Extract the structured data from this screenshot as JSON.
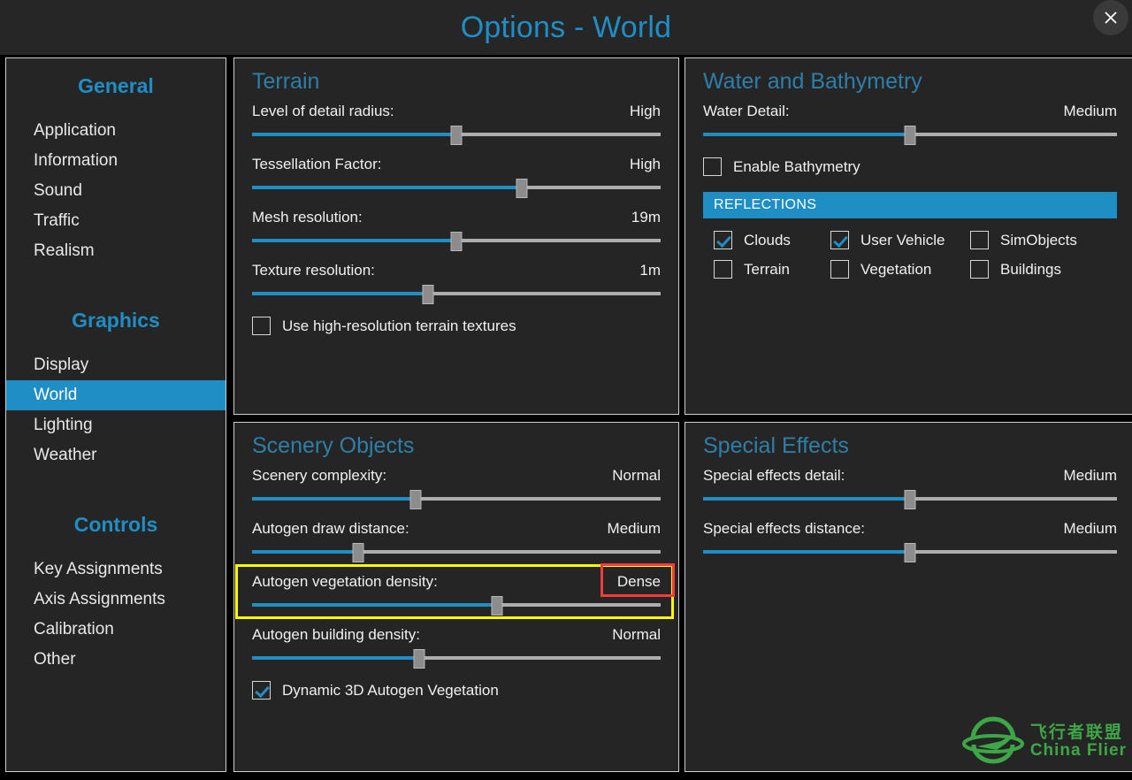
{
  "window": {
    "title": "Options - World",
    "close_label": "×",
    "accent_color": "#1f8ec4",
    "panel_bg": "#252525",
    "highlight_yellow": "#ffff00",
    "highlight_red": "#f03c3c"
  },
  "sidebar": {
    "groups": [
      {
        "heading": "General",
        "items": [
          {
            "label": "Application",
            "active": false
          },
          {
            "label": "Information",
            "active": false
          },
          {
            "label": "Sound",
            "active": false
          },
          {
            "label": "Traffic",
            "active": false
          },
          {
            "label": "Realism",
            "active": false
          }
        ]
      },
      {
        "heading": "Graphics",
        "items": [
          {
            "label": "Display",
            "active": false
          },
          {
            "label": "World",
            "active": true
          },
          {
            "label": "Lighting",
            "active": false
          },
          {
            "label": "Weather",
            "active": false
          }
        ]
      },
      {
        "heading": "Controls",
        "items": [
          {
            "label": "Key Assignments",
            "active": false
          },
          {
            "label": "Axis Assignments",
            "active": false
          },
          {
            "label": "Calibration",
            "active": false
          },
          {
            "label": "Other",
            "active": false
          }
        ]
      }
    ]
  },
  "terrain": {
    "title": "Terrain",
    "sliders": [
      {
        "label": "Level of detail radius:",
        "value": "High",
        "percent": 50
      },
      {
        "label": "Tessellation Factor:",
        "value": "High",
        "percent": 66
      },
      {
        "label": "Mesh resolution:",
        "value": "19m",
        "percent": 50
      },
      {
        "label": "Texture resolution:",
        "value": "1m",
        "percent": 43
      }
    ],
    "checkbox": {
      "label": "Use high-resolution terrain textures",
      "checked": false
    }
  },
  "water": {
    "title": "Water and Bathymetry",
    "sliders": [
      {
        "label": "Water Detail:",
        "value": "Medium",
        "percent": 50
      }
    ],
    "checkbox": {
      "label": "Enable Bathymetry",
      "checked": false
    },
    "reflections_header": "REFLECTIONS",
    "reflections": [
      {
        "label": "Clouds",
        "checked": true
      },
      {
        "label": "User Vehicle",
        "checked": true
      },
      {
        "label": "SimObjects",
        "checked": false
      },
      {
        "label": "Terrain",
        "checked": false
      },
      {
        "label": "Vegetation",
        "checked": false
      },
      {
        "label": "Buildings",
        "checked": false
      }
    ]
  },
  "scenery": {
    "title": "Scenery Objects",
    "sliders": [
      {
        "label": "Scenery complexity:",
        "value": "Normal",
        "percent": 40
      },
      {
        "label": "Autogen draw distance:",
        "value": "Medium",
        "percent": 26
      },
      {
        "label": "Autogen vegetation density:",
        "value": "Dense",
        "percent": 60
      },
      {
        "label": "Autogen building density:",
        "value": "Normal",
        "percent": 41
      }
    ],
    "checkbox": {
      "label": "Dynamic 3D Autogen Vegetation",
      "checked": true
    }
  },
  "effects": {
    "title": "Special Effects",
    "sliders": [
      {
        "label": "Special effects detail:",
        "value": "Medium",
        "percent": 50
      },
      {
        "label": "Special effects distance:",
        "value": "Medium",
        "percent": 50
      }
    ]
  },
  "watermark": {
    "cn": "飞行者联盟",
    "en": "China Flier",
    "color": "#3fae49"
  }
}
